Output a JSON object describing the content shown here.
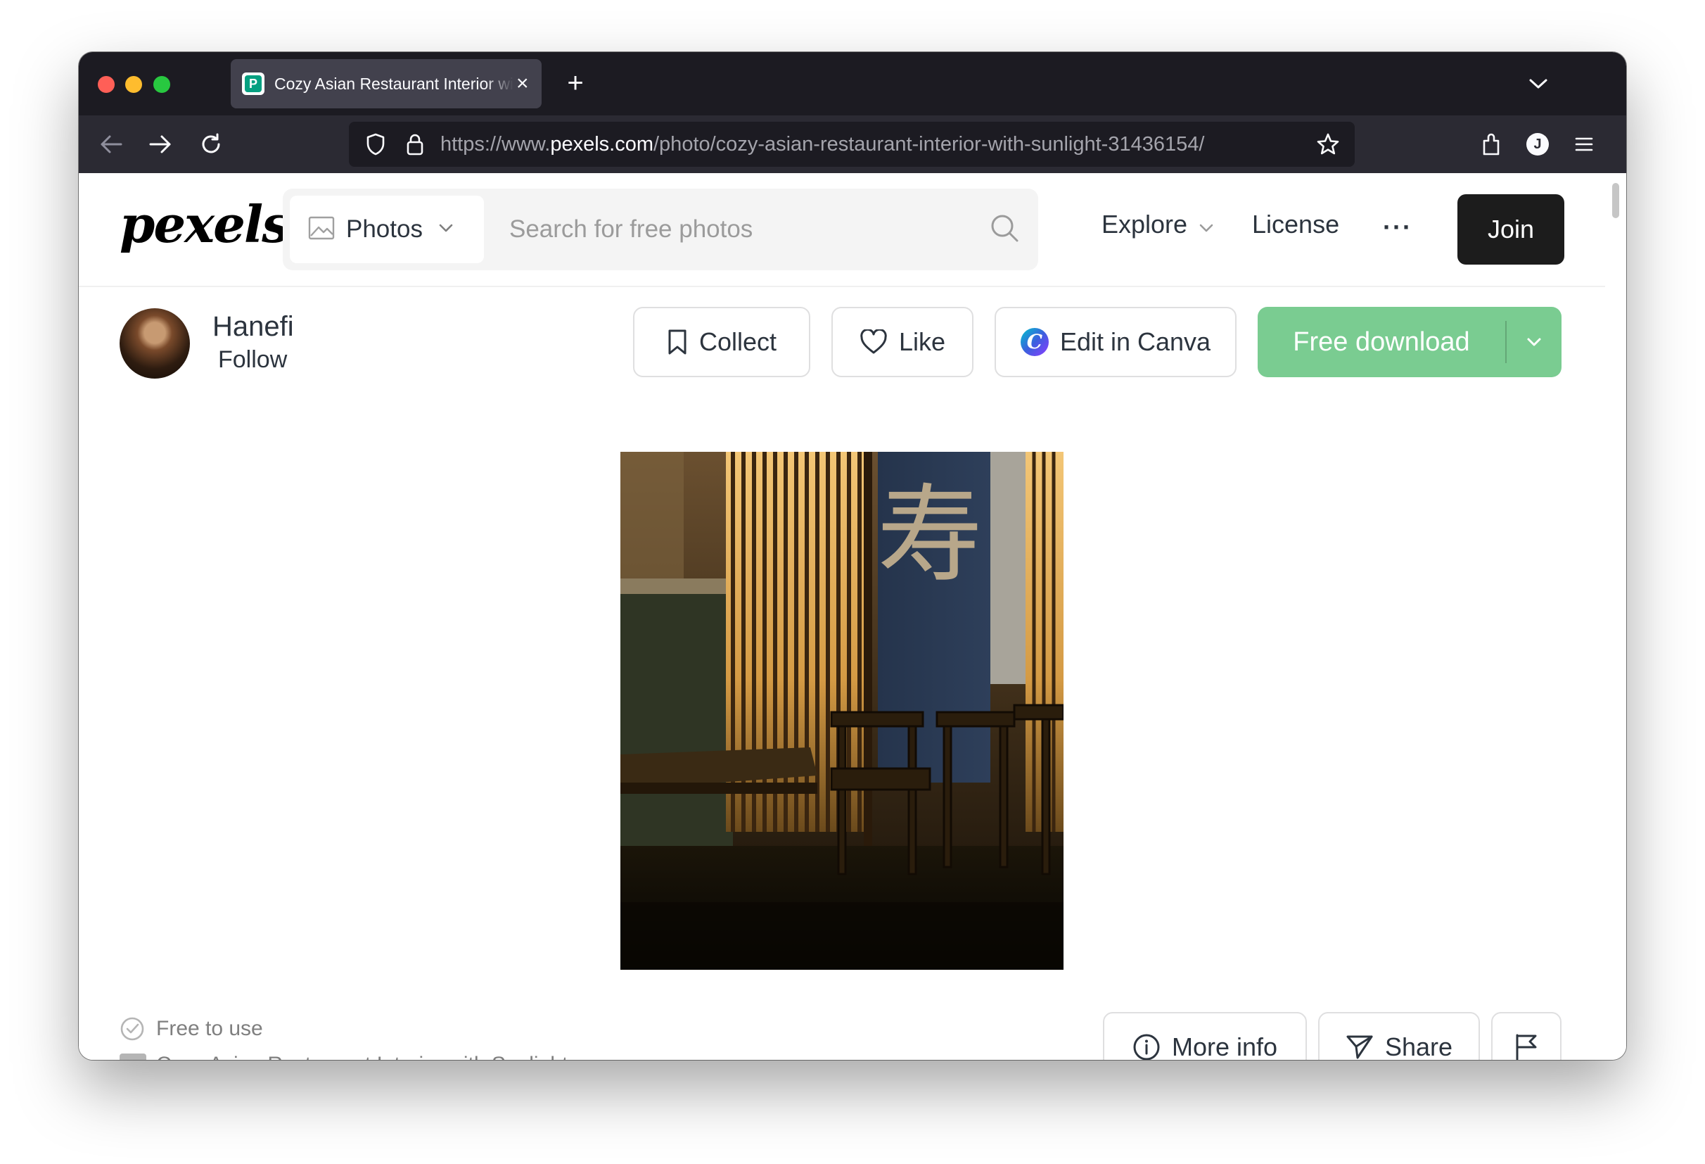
{
  "browser": {
    "tab_title": "Cozy Asian Restaurant Interior with Sunlight · Free Stock Photo",
    "tab_favicon_letter": "P",
    "url_prefix": "https://www.",
    "url_host": "pexels.com",
    "url_path": "/photo/cozy-asian-restaurant-interior-with-sunlight-31436154/",
    "profile_initial": "J",
    "icons": [
      "back-icon",
      "forward-icon",
      "reload-icon",
      "shield-icon",
      "lock-icon",
      "star-icon",
      "extensions-icon",
      "profile-icon",
      "menu-icon",
      "tab-list-chevron-icon",
      "new-tab-icon",
      "close-icon"
    ]
  },
  "header": {
    "logo": "pexels",
    "search_type_label": "Photos",
    "search_placeholder": "Search for free photos",
    "explore_label": "Explore",
    "license_label": "License",
    "more_label": "···",
    "join_label": "Join"
  },
  "photographer": {
    "name": "Hanefi",
    "follow_label": "Follow"
  },
  "actions": {
    "collect_label": "Collect",
    "like_label": "Like",
    "canva_label": "Edit in Canva",
    "canva_logo_letter": "C",
    "download_label": "Free download"
  },
  "photo": {
    "banner_glyph": "寿"
  },
  "footer": {
    "free_label": "Free to use",
    "cc_badge": "CC",
    "photo_title": "Cozy Asian Restaurant Interior with Sunlight",
    "more_info_label": "More info",
    "share_label": "Share"
  },
  "colors": {
    "download_green": "#7acc91",
    "join_black": "#1c1c1c",
    "tab_strip": "#1c1b22",
    "nav_bar": "#2b2a33"
  }
}
